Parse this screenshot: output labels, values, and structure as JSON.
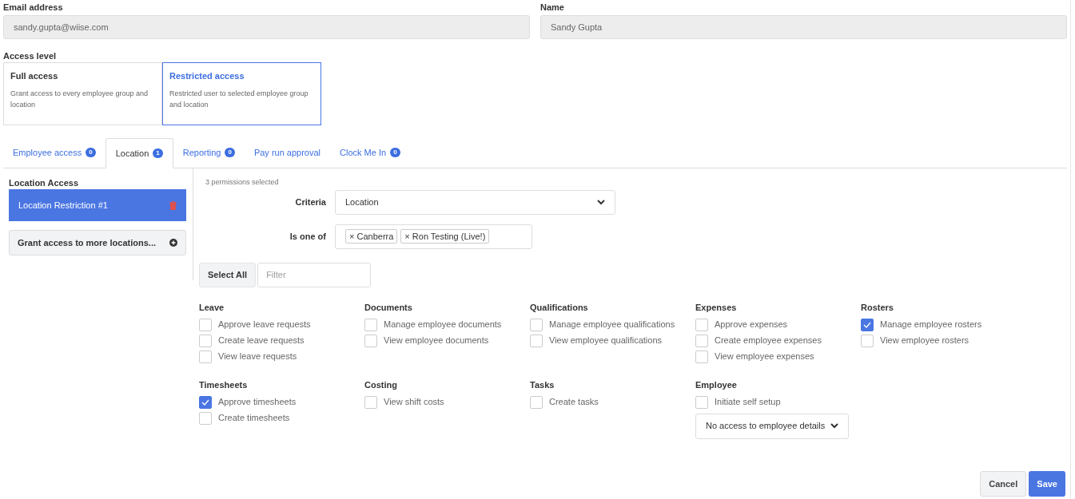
{
  "fields": [
    {
      "label": "Email address",
      "value": "sandy.gupta@wiise.com"
    },
    {
      "label": "Name",
      "value": "Sandy Gupta"
    }
  ],
  "access_level": {
    "label": "Access level",
    "options": [
      {
        "title": "Full access",
        "description": "Grant access to every employee group and location",
        "selected": false
      },
      {
        "title": "Restricted access",
        "description": "Restricted user to selected employee group and location",
        "selected": true
      }
    ]
  },
  "tabs": [
    {
      "label": "Employee access",
      "badge": "0",
      "selected": false
    },
    {
      "label": "Location",
      "badge": "1",
      "selected": true
    },
    {
      "label": "Reporting",
      "badge": "0",
      "selected": false
    },
    {
      "label": "Pay run approval",
      "selected": false
    },
    {
      "label": "Clock Me In",
      "badge": "0",
      "selected": false
    }
  ],
  "sidebar": {
    "title": "Location Access",
    "items": [
      {
        "label": "Location Restriction #1",
        "selected": true
      }
    ],
    "add_button": "Grant access to more locations..."
  },
  "permissions_count": "3 permissions selected",
  "criteria": {
    "label": "Criteria",
    "value": "Location"
  },
  "is_one_of": {
    "label": "Is one of",
    "tags": [
      "× Canberra",
      "× Ron Testing (Live!)"
    ]
  },
  "select_all": "Select All",
  "filter": {
    "placeholder": "Filter"
  },
  "groups": [
    {
      "title": "Leave",
      "items": [
        {
          "label": "Approve leave requests",
          "checked": false
        },
        {
          "label": "Create leave requests",
          "checked": false
        },
        {
          "label": "View leave requests",
          "checked": false
        }
      ]
    },
    {
      "title": "Documents",
      "items": [
        {
          "label": "Manage employee documents",
          "checked": false
        },
        {
          "label": "View employee documents",
          "checked": false
        }
      ]
    },
    {
      "title": "Qualifications",
      "items": [
        {
          "label": "Manage employee qualifications",
          "checked": false
        },
        {
          "label": "View employee qualifications",
          "checked": false
        }
      ]
    },
    {
      "title": "Expenses",
      "items": [
        {
          "label": "Approve expenses",
          "checked": false
        },
        {
          "label": "Create employee expenses",
          "checked": false
        },
        {
          "label": "View employee expenses",
          "checked": false
        }
      ]
    },
    {
      "title": "Rosters",
      "items": [
        {
          "label": "Manage employee rosters",
          "checked": true
        },
        {
          "label": "View employee rosters",
          "checked": false
        }
      ]
    },
    {
      "title": "Timesheets",
      "items": [
        {
          "label": "Approve timesheets",
          "checked": true
        },
        {
          "label": "Create timesheets",
          "checked": false
        }
      ]
    },
    {
      "title": "Costing",
      "items": [
        {
          "label": "View shift costs",
          "checked": false
        }
      ]
    },
    {
      "title": "Tasks",
      "items": [
        {
          "label": "Create tasks",
          "checked": false
        }
      ]
    },
    {
      "title": "Employee",
      "items": [
        {
          "label": "Initiate self setup",
          "checked": false
        }
      ],
      "select": "No access to employee details"
    }
  ],
  "buttons": {
    "cancel": "Cancel",
    "save": "Save"
  }
}
